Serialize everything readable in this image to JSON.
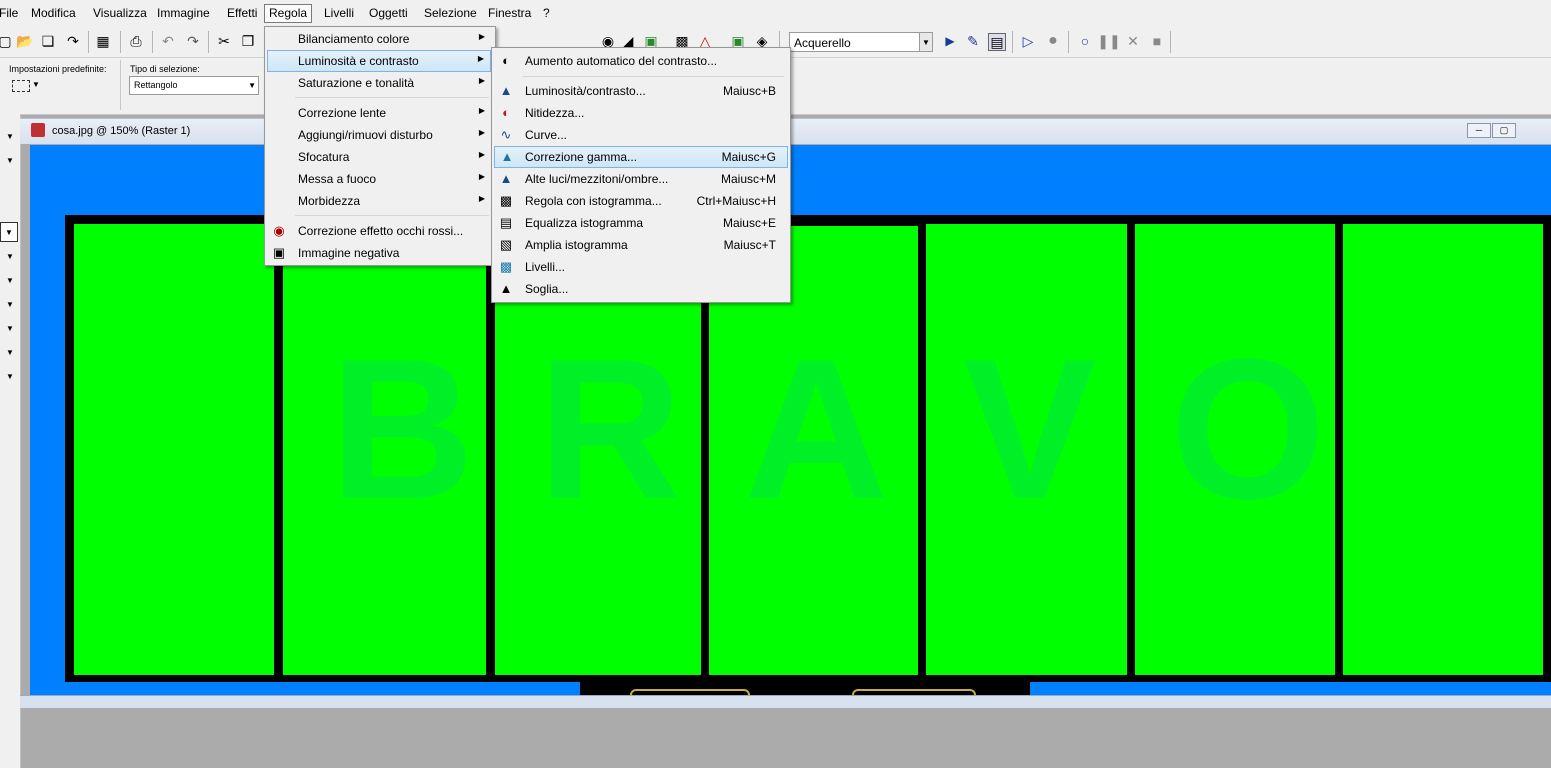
{
  "menubar": {
    "items": [
      "File",
      "Modifica",
      "Visualizza",
      "Immagine",
      "Effetti",
      "Regola",
      "Livelli",
      "Oggetti",
      "Selezione",
      "Finestra",
      "?"
    ],
    "active": "Regola"
  },
  "toolbar": {
    "script_value": "Acquerello",
    "icons": {
      "new": "new-file-icon",
      "open": "open-folder-icon",
      "copy_doc": "copy-icon",
      "save": "save-disk-icon",
      "print": "print-icon",
      "undo": "undo-icon",
      "redo": "redo-icon",
      "cut": "scissors-icon",
      "paste": "paste-icon",
      "run": "play-icon",
      "record": "record-icon",
      "pause": "pause-icon",
      "stop": "stop-icon",
      "close": "close-x-icon"
    }
  },
  "options": {
    "preset_label": "Impostazioni predefinite:",
    "selection_type_label": "Tipo di selezione:",
    "selection_type_value": "Rettangolo"
  },
  "document": {
    "title": "cosa.jpg @ 150% (Raster 1)",
    "letters": [
      "B",
      "R",
      "A",
      "V",
      "O"
    ],
    "colors": {
      "background": "#0080ff",
      "panel": "#00ff00",
      "letter": "#00f028",
      "border": "#000000"
    }
  },
  "regola_menu": {
    "items": [
      {
        "label": "Bilanciamento colore",
        "submenu": true
      },
      {
        "label": "Luminosità e contrasto",
        "submenu": true
      },
      {
        "label": "Saturazione e tonalità",
        "submenu": true
      },
      {
        "label": "Correzione lente",
        "submenu": true
      },
      {
        "label": "Aggiungi/rimuovi disturbo",
        "submenu": true
      },
      {
        "label": "Sfocatura",
        "submenu": true
      },
      {
        "label": "Messa a fuoco",
        "submenu": true
      },
      {
        "label": "Morbidezza",
        "submenu": true
      },
      {
        "label": "Correzione effetto occhi rossi...",
        "submenu": false,
        "icon": "red-eye-icon"
      },
      {
        "label": "Immagine negativa",
        "submenu": false,
        "icon": "negative-image-icon"
      }
    ]
  },
  "luminosity_submenu": {
    "items": [
      {
        "label": "Aumento automatico del contrasto...",
        "shortcut": "",
        "icon": "auto-contrast-icon"
      },
      {
        "label": "Luminosità/contrasto...",
        "shortcut": "Maiusc+B",
        "icon": "brightness-contrast-icon"
      },
      {
        "label": "Nitidezza...",
        "shortcut": "",
        "icon": "clarity-icon"
      },
      {
        "label": "Curve...",
        "shortcut": "",
        "icon": "curves-icon"
      },
      {
        "label": "Correzione gamma...",
        "shortcut": "Maiusc+G",
        "icon": "gamma-icon"
      },
      {
        "label": "Alte luci/mezzitoni/ombre...",
        "shortcut": "Maiusc+M",
        "icon": "highlights-icon"
      },
      {
        "label": "Regola con istogramma...",
        "shortcut": "Ctrl+Maiusc+H",
        "icon": "histogram-adjust-icon"
      },
      {
        "label": "Equalizza istogramma",
        "shortcut": "Maiusc+E",
        "icon": "histogram-equalize-icon"
      },
      {
        "label": "Amplia istogramma",
        "shortcut": "Maiusc+T",
        "icon": "histogram-stretch-icon"
      },
      {
        "label": "Livelli...",
        "shortcut": "",
        "icon": "levels-icon"
      },
      {
        "label": "Soglia...",
        "shortcut": "",
        "icon": "threshold-icon"
      }
    ]
  }
}
